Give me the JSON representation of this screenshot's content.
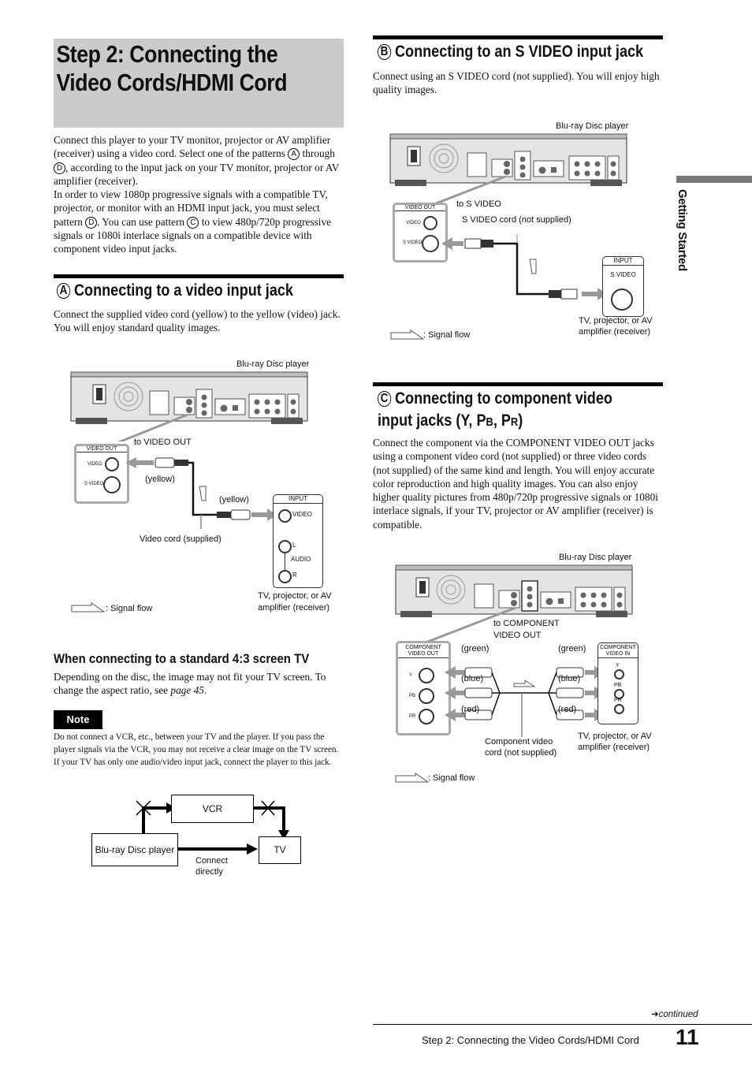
{
  "page": {
    "title_line1": "Step 2: Connecting the",
    "title_line2": "Video Cords/HDMI Cord",
    "intro_p1_a": "Connect this player to your TV monitor, projector or AV amplifier (receiver) using a video cord. Select one of the patterns ",
    "intro_p1_b": " through ",
    "intro_p1_c": ", according to the input jack on your TV monitor, projector or AV amplifier (receiver).",
    "intro_p2_a": "In order to view 1080p progressive signals with a compatible TV, projector, or monitor with an HDMI input jack, you must select pattern ",
    "intro_p2_b": ". You can use pattern ",
    "intro_p2_c": " to view 480p/720p progressive signals or 1080i interlace signals on a compatible device with component video input jacks.",
    "pattern_a": "A",
    "pattern_b": "B",
    "pattern_c": "C",
    "pattern_d": "D"
  },
  "side_tab": {
    "label": "Getting Started"
  },
  "section_a": {
    "letter": "A",
    "heading": "Connecting to a video input jack",
    "body": "Connect the supplied video cord (yellow) to the yellow (video) jack. You will enjoy standard quality images.",
    "diagram": {
      "player_label": "Blu-ray Disc player",
      "to_label": "to VIDEO OUT",
      "out_panel_title": "VIDEO OUT",
      "out_jack_1": "VIDEO",
      "out_jack_2": "S VIDEO",
      "cord_color_1": "(yellow)",
      "cord_color_2": "(yellow)",
      "cord_label": "Video cord (supplied)",
      "in_panel_title": "INPUT",
      "in_jack_video": "VIDEO",
      "in_jack_l": "L",
      "in_jack_audio": "AUDIO",
      "in_jack_r": "R",
      "tv_label_1": "TV, projector, or AV",
      "tv_label_2": "amplifier (receiver)",
      "signal_flow": ": Signal flow"
    },
    "sub_heading": "When connecting to a standard 4:3 screen TV",
    "sub_body_a": "Depending on the disc, the image may not fit your TV screen. To change the aspect ratio, see ",
    "sub_body_link": "page 45",
    "sub_body_b": ".",
    "note_label": "Note",
    "note_text": "Do not connect a VCR, etc., between your TV and the player. If you pass the player signals via the VCR, you may not receive a clear image on the TV screen. If your TV has only one audio/video input jack, connect the player to this jack.",
    "flow": {
      "vcr": "VCR",
      "player": "Blu-ray Disc player",
      "tv": "TV",
      "direct_1": "Connect",
      "direct_2": "directly"
    }
  },
  "section_b": {
    "letter": "B",
    "heading": "Connecting to an S VIDEO input jack",
    "body": "Connect using an S VIDEO cord (not supplied). You will enjoy high quality images.",
    "diagram": {
      "player_label": "Blu-ray Disc player",
      "to_label": "to S VIDEO",
      "cord_label": "S VIDEO cord (not supplied)",
      "out_panel_title": "VIDEO OUT",
      "out_jack_1": "VIDEO",
      "out_jack_2": "S VIDEO",
      "in_panel_title": "INPUT",
      "in_jack": "S VIDEO",
      "tv_label_1": "TV, projector, or AV",
      "tv_label_2": "amplifier (receiver)",
      "signal_flow": ": Signal flow"
    }
  },
  "section_c": {
    "letter": "C",
    "heading_line1": "Connecting to component video",
    "heading_line2_a": "input jacks (Y, P",
    "heading_line2_b": "B",
    "heading_line2_c": ", P",
    "heading_line2_d": "R",
    "heading_line2_e": ")",
    "body": "Connect the component via the COMPONENT VIDEO OUT jacks using a component video cord (not supplied) or three video cords (not supplied) of the same kind and length. You will enjoy accurate color reproduction and high quality images. You can also enjoy higher quality pictures from 480p/720p progressive signals or 1080i interlace signals, if your TV, projector or AV amplifier (receiver) is compatible.",
    "diagram": {
      "player_label": "Blu-ray Disc player",
      "to_label_1": "to COMPONENT",
      "to_label_2": "VIDEO OUT",
      "out_panel_title_1": "COMPONENT",
      "out_panel_title_2": "VIDEO OUT",
      "out_jack_y": "Y",
      "out_jack_pb": "PB",
      "out_jack_pr": "PR",
      "color_green": "(green)",
      "color_blue": "(blue)",
      "color_red": "(red)",
      "in_panel_title_1": "COMPONENT",
      "in_panel_title_2": "VIDEO IN",
      "in_jack_y": "Y",
      "in_jack_pb": "PB",
      "in_jack_pr": "PR",
      "cord_label_1": "Component video",
      "cord_label_2": "cord (not supplied)",
      "tv_label_1": "TV, projector, or AV",
      "tv_label_2": "amplifier (receiver)",
      "signal_flow": ": Signal flow"
    }
  },
  "footer": {
    "continued": "continued",
    "running_title": "Step 2: Connecting the Video Cords/HDMI Cord",
    "page_number": "11"
  }
}
